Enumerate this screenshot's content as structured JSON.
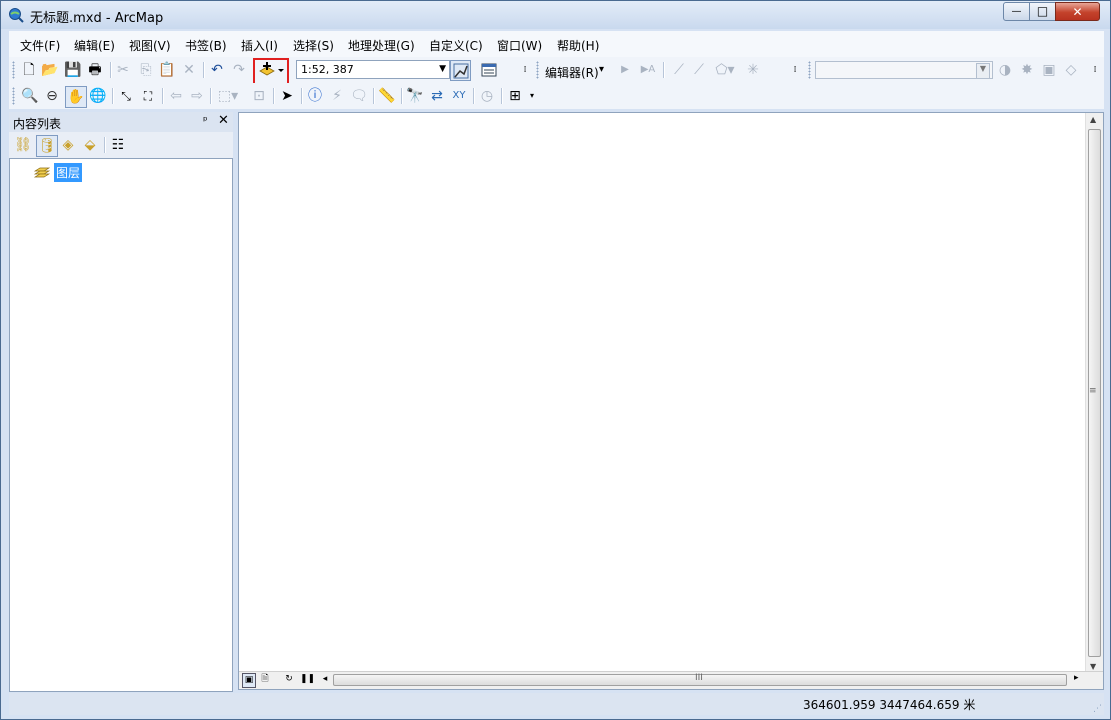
{
  "window": {
    "title": "无标题.mxd - ArcMap",
    "min_glyph": "—",
    "max_glyph": "□",
    "close_glyph": "✕"
  },
  "menu": [
    "文件(F)",
    "编辑(E)",
    "视图(V)",
    "书签(B)",
    "插入(I)",
    "选择(S)",
    "地理处理(G)",
    "自定义(C)",
    "窗口(W)",
    "帮助(H)"
  ],
  "standard_toolbar": {
    "scale_value": "1:52, 387",
    "add_data_icon": "add-data-icon",
    "editor_menu_label": "编辑器(R)",
    "editor_dropdown_glyph": "▾"
  },
  "toc": {
    "title": "内容列表",
    "pin_glyph": "ᵖ",
    "close_glyph": "✕",
    "layer_root": "图层"
  },
  "map": {
    "scroll_grip_h": "III",
    "scroll_grip_v": "≡"
  },
  "status": {
    "coordinates": "364601.959  3447464.659 米"
  },
  "colors": {
    "highlight": "#e02020",
    "selection": "#3399ff",
    "chrome": "#d6e2f3"
  }
}
